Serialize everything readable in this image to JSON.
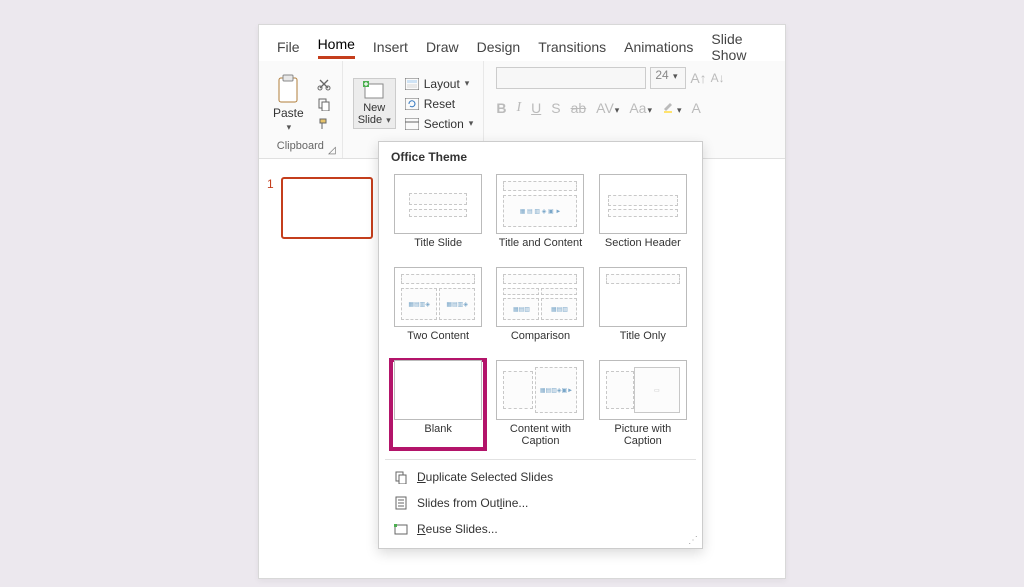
{
  "tabs": [
    "File",
    "Home",
    "Insert",
    "Draw",
    "Design",
    "Transitions",
    "Animations",
    "Slide Show"
  ],
  "active_tab": 1,
  "clipboard": {
    "paste": "Paste",
    "group_label": "Clipboard"
  },
  "slides_group": {
    "new_slide_line1": "New",
    "new_slide_line2": "Slide",
    "layout": "Layout",
    "reset": "Reset",
    "section": "Section"
  },
  "font_group": {
    "size": "24",
    "buttons": [
      "B",
      "I",
      "U",
      "S",
      "ab",
      "AV",
      "Aa"
    ]
  },
  "slide_panel": {
    "num": "1"
  },
  "dropdown": {
    "header": "Office Theme",
    "layouts": [
      "Title Slide",
      "Title and Content",
      "Section Header",
      "Two Content",
      "Comparison",
      "Title Only",
      "Blank",
      "Content with Caption",
      "Picture with Caption"
    ],
    "highlighted": 6,
    "actions": {
      "duplicate": "Duplicate Selected Slides",
      "outline": "Slides from Outline...",
      "reuse": "Reuse Slides..."
    }
  }
}
